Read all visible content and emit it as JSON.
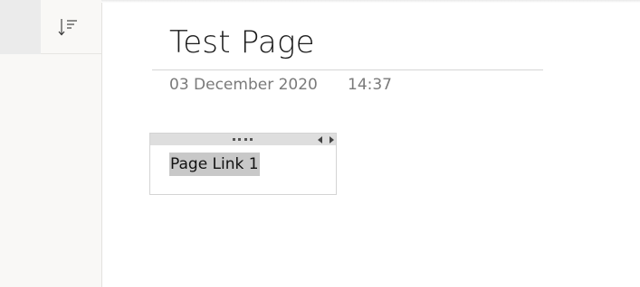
{
  "sidebar": {
    "sort_icon": "sort-descending-icon"
  },
  "page": {
    "title": "Test Page",
    "date": "03 December 2020",
    "time": "14:37"
  },
  "note_container": {
    "drag_icon": "drag-handle-icon",
    "resize_icon": "left-right-resize-icon",
    "link_text": "Page Link 1"
  },
  "colors": {
    "sidebar_bg": "#f9f8f6",
    "selection_bg": "#c8c8c8",
    "meta_text": "#7a7a7a"
  }
}
